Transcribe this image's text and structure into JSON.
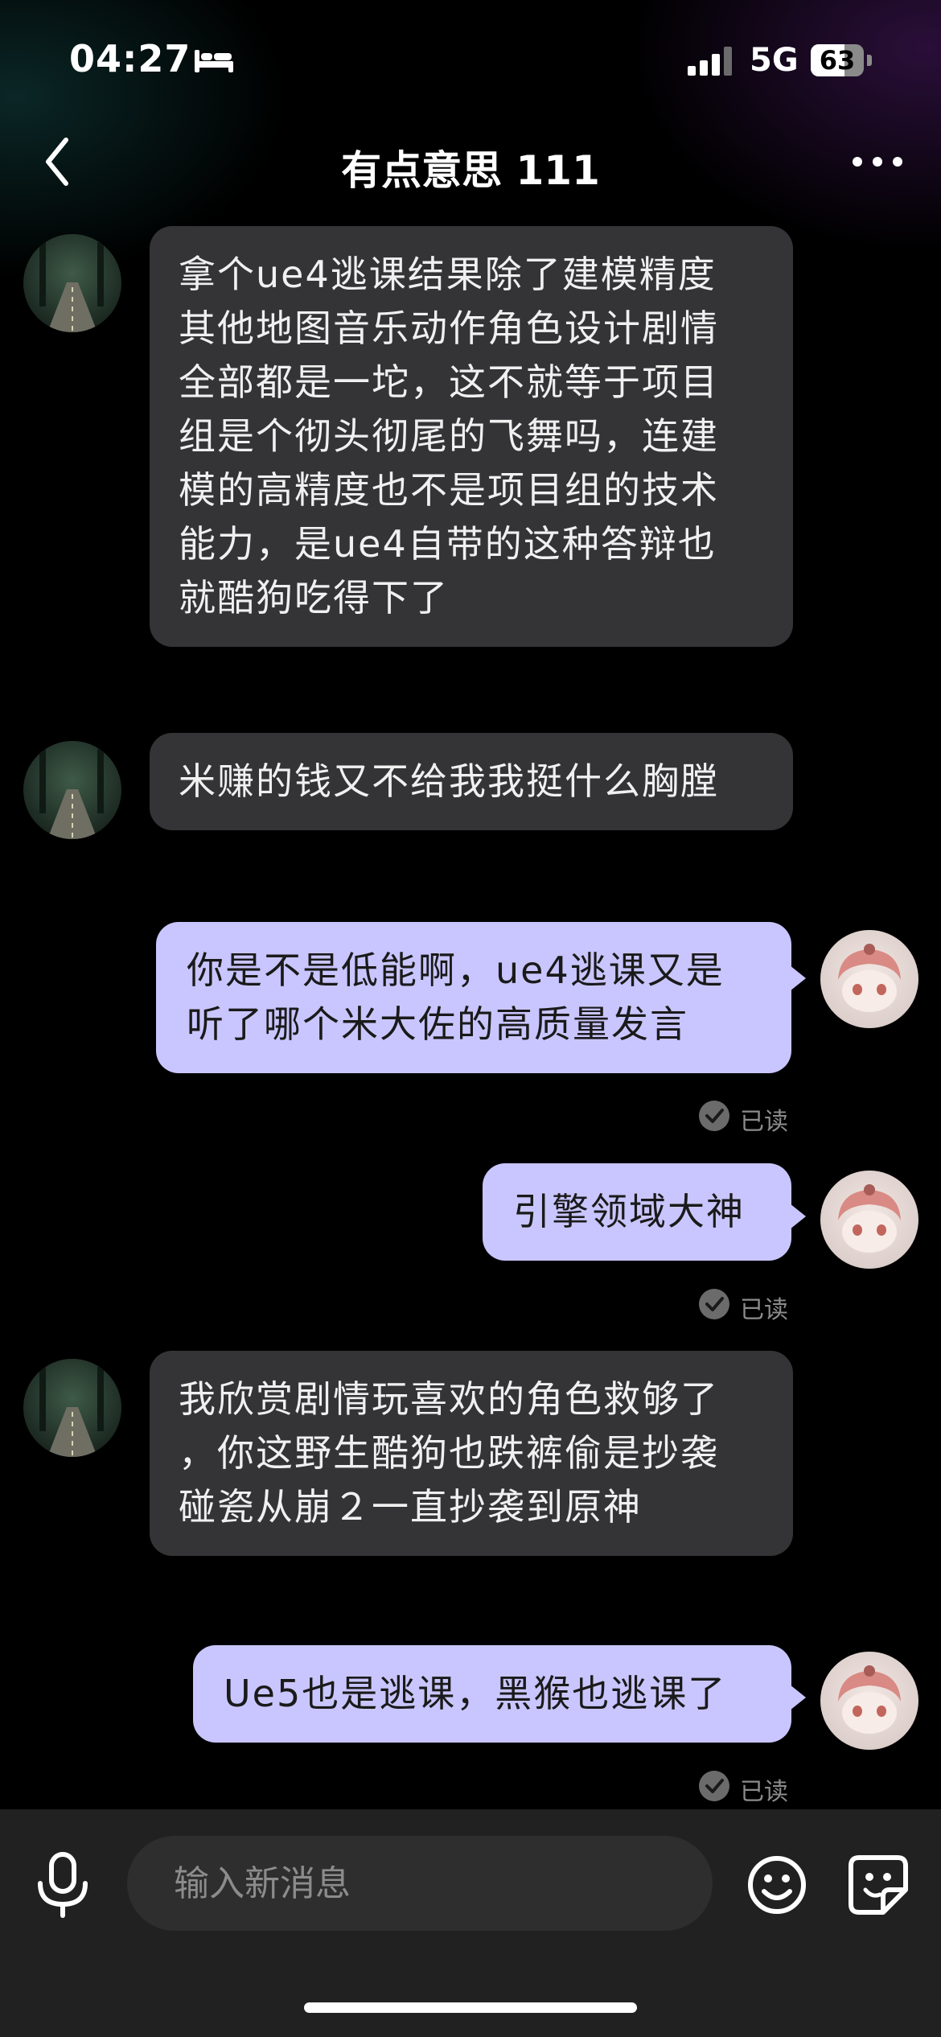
{
  "status_bar": {
    "time": "04:27",
    "network": "5G",
    "battery_percent": "63",
    "battery_level": 0.63,
    "icons": [
      "bed-icon",
      "signal-icon",
      "battery-icon"
    ]
  },
  "nav": {
    "title": "有点意思 111",
    "icons": [
      "back-icon",
      "more-icon"
    ]
  },
  "messages": [
    {
      "sender": "other",
      "lines": [
        "拿个ue4逃课结果除了建模精度",
        "其他地图音乐动作角色设计剧情",
        "全部都是一坨，这不就等于项目",
        "组是个彻头彻尾的飞舞吗，连建",
        "模的高精度也不是项目组的技术",
        "能力，是ue4自带的这种答辩也",
        "就酷狗吃得下了"
      ]
    },
    {
      "sender": "other",
      "lines": [
        "米赚的钱又不给我我挺什么胸膛"
      ]
    },
    {
      "sender": "me",
      "lines": [
        "你是不是低能啊，ue4逃课又是",
        "听了哪个米大佐的高质量发言"
      ],
      "status": "已读"
    },
    {
      "sender": "me",
      "lines": [
        "引擎领域大神"
      ],
      "status": "已读"
    },
    {
      "sender": "other",
      "lines": [
        "我欣赏剧情玩喜欢的角色救够了",
        "，你这野生酷狗也跌裤偷是抄袭",
        "碰瓷从崩２一直抄袭到原神"
      ]
    },
    {
      "sender": "me",
      "lines": [
        "Ue5也是逃课，黑猴也逃课了"
      ],
      "status": "已读"
    }
  ],
  "input_bar": {
    "placeholder": "输入新消息",
    "icons": [
      "mic-icon",
      "emoji-icon",
      "sticker-icon"
    ]
  },
  "colors": {
    "background": "#000000",
    "incoming_bubble": "#343437",
    "outgoing_bubble": "#c9c6ff",
    "input_bar": "#212121"
  }
}
